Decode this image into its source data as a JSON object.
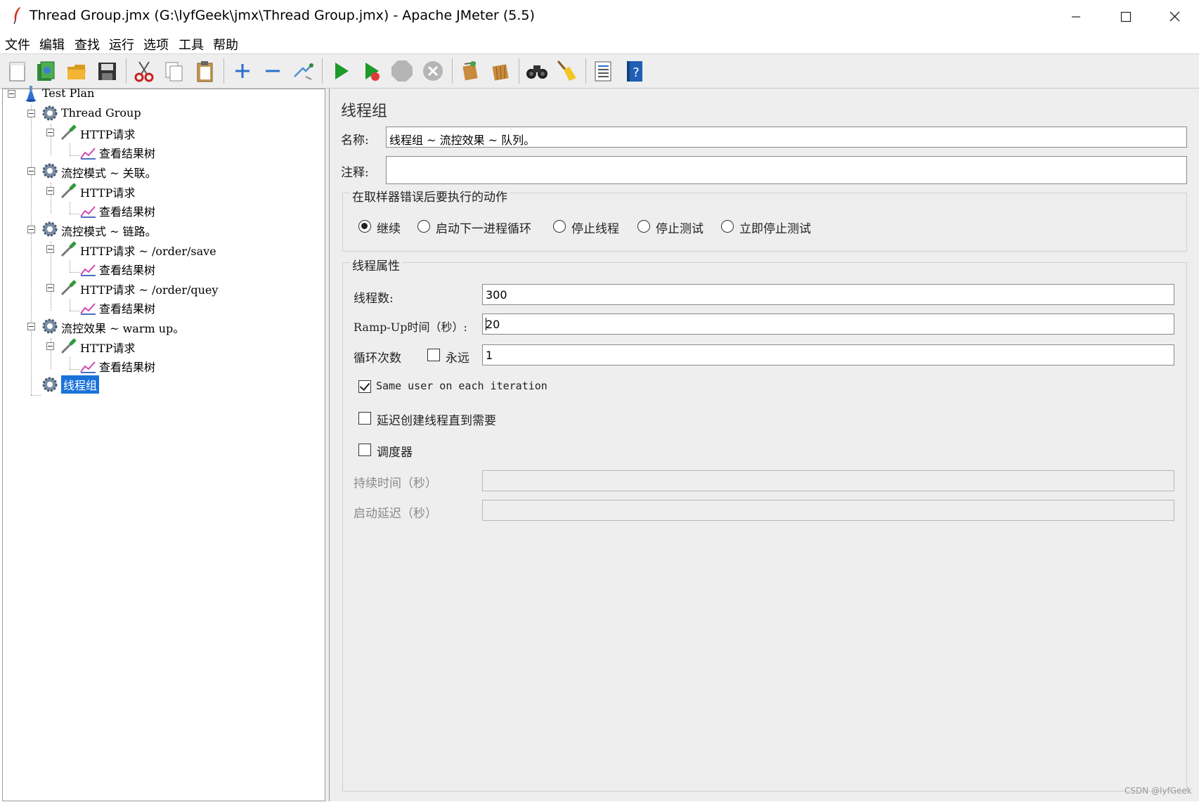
{
  "window": {
    "title": "Thread Group.jmx (G:\\lyfGeek\\jmx\\Thread Group.jmx) - Apache JMeter (5.5)"
  },
  "menu": [
    "文件",
    "编辑",
    "查找",
    "运行",
    "选项",
    "工具",
    "帮助"
  ],
  "toolbar": {
    "buttons": [
      "new-icon",
      "templates-icon",
      "open-icon",
      "save-icon",
      "cut-icon",
      "copy-icon",
      "paste-icon",
      "expand-icon",
      "collapse-icon",
      "toggle-icon",
      "start-icon",
      "start-no-pause-icon",
      "stop-icon",
      "shutdown-icon",
      "clear-icon",
      "clear-all-icon",
      "search-icon",
      "reset-search-icon",
      "function-helper-icon",
      "help-icon"
    ]
  },
  "tree": {
    "nodes": [
      {
        "label": "Test Plan",
        "icon": "test-plan-icon",
        "depth": 0
      },
      {
        "label": "Thread Group",
        "icon": "gear-icon",
        "depth": 1
      },
      {
        "label": "HTTP请求",
        "icon": "pipette-icon",
        "depth": 2
      },
      {
        "label": "查看结果树",
        "icon": "listener-icon",
        "depth": 3
      },
      {
        "label": "流控模式 ~ 关联。",
        "icon": "gear-icon",
        "depth": 1
      },
      {
        "label": "HTTP请求",
        "icon": "pipette-icon",
        "depth": 2
      },
      {
        "label": "查看结果树",
        "icon": "listener-icon",
        "depth": 3
      },
      {
        "label": "流控模式 ~ 链路。",
        "icon": "gear-icon",
        "depth": 1
      },
      {
        "label": "HTTP请求 ~ /order/save",
        "icon": "pipette-icon",
        "depth": 2
      },
      {
        "label": "查看结果树",
        "icon": "listener-icon",
        "depth": 3
      },
      {
        "label": "HTTP请求 ~ /order/quey",
        "icon": "pipette-icon",
        "depth": 2
      },
      {
        "label": "查看结果树",
        "icon": "listener-icon",
        "depth": 3
      },
      {
        "label": "流控效果 ~ warm up。",
        "icon": "gear-icon",
        "depth": 1
      },
      {
        "label": "HTTP请求",
        "icon": "pipette-icon",
        "depth": 2
      },
      {
        "label": "查看结果树",
        "icon": "listener-icon",
        "depth": 3
      },
      {
        "label": "线程组",
        "icon": "gear-icon",
        "depth": 1,
        "selected": true
      }
    ]
  },
  "panel": {
    "heading": "线程组",
    "name_label": "名称:",
    "name_value": "线程组 ~ 流控效果 ~ 队列。",
    "comment_label": "注释:",
    "comment_value": "",
    "error_action": {
      "title": "在取样器错误后要执行的动作",
      "options": [
        "继续",
        "启动下一进程循环",
        "停止线程",
        "停止测试",
        "立即停止测试"
      ],
      "selected": "继续"
    },
    "thread_props": {
      "title": "线程属性",
      "threads_label": "线程数:",
      "threads_value": "300",
      "rampup_label": "Ramp-Up时间（秒）:",
      "rampup_value": "20",
      "loop_label": "循环次数",
      "forever_label": "永远",
      "forever_checked": false,
      "loop_value": "1",
      "same_user_label": "Same user on each iteration",
      "same_user_checked": true,
      "delay_label": "延迟创建线程直到需要",
      "delay_checked": false,
      "scheduler_label": "调度器",
      "scheduler_checked": false,
      "duration_label": "持续时间（秒）",
      "duration_value": "",
      "startup_delay_label": "启动延迟（秒）",
      "startup_delay_value": ""
    }
  },
  "watermark": "CSDN @lyfGeek"
}
